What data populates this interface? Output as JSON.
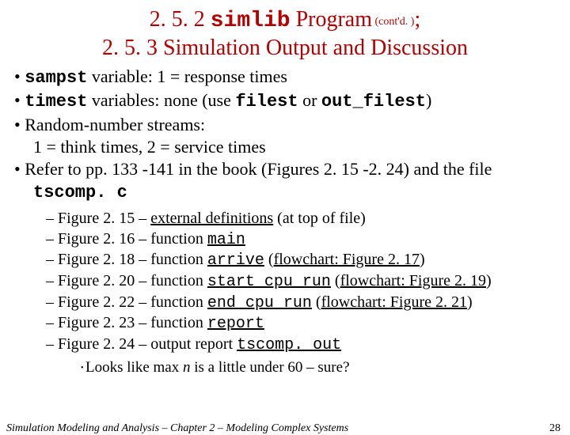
{
  "title": {
    "pre1": "2. 5. 2 ",
    "mono": "simlib",
    "post1": " Program",
    "contd": " (cont'd. )",
    "semi": ";",
    "line2": "2. 5. 3  Simulation Output and Discussion"
  },
  "bullets": {
    "b1": {
      "var": "sampst",
      "rest": " variable: 1 = response times"
    },
    "b2": {
      "var": "timest",
      "mid": " variables:  none (use ",
      "f1": "filest",
      "or": " or ",
      "f2": "out_filest",
      "close": ")"
    },
    "b3": {
      "l1": "Random-number streams:",
      "l2": "1 = think times, 2 = service times"
    },
    "b4": {
      "pre": "Refer to pp. 133 -141 in the book (Figures 2. 15 -2. 24) and the file ",
      "file": "tscomp. c"
    }
  },
  "sub": {
    "s1": {
      "a": "Figure 2. 15 – ",
      "u": "external definitions",
      "b": " (at top of file)"
    },
    "s2": {
      "a": "Figure 2. 16 – function ",
      "u": "main"
    },
    "s3": {
      "a": "Figure 2. 18 – function ",
      "u": "arrive",
      "b": " (",
      "fl": "flowchart: Figure 2. 17",
      "c": ")"
    },
    "s4": {
      "a": "Figure 2. 20 – function ",
      "u": "start_cpu_run",
      "b": " (",
      "fl": "flowchart: Figure 2. 19",
      "c": ")"
    },
    "s5": {
      "a": "Figure 2. 22 – function ",
      "u": "end_cpu_run",
      "b": " (",
      "fl": "flowchart: Figure 2. 21",
      "c": ")"
    },
    "s6": {
      "a": "Figure 2. 23 – function ",
      "u": "report"
    },
    "s7": {
      "a": "Figure 2. 24 – output report ",
      "u": "tscomp. out"
    }
  },
  "subsub": {
    "pre": "Looks like max ",
    "n": "n",
    "post": " is a little under 60 – sure?"
  },
  "footer": {
    "text": "Simulation Modeling and Analysis – Chapter 2 – Modeling Complex Systems",
    "page": "28"
  }
}
